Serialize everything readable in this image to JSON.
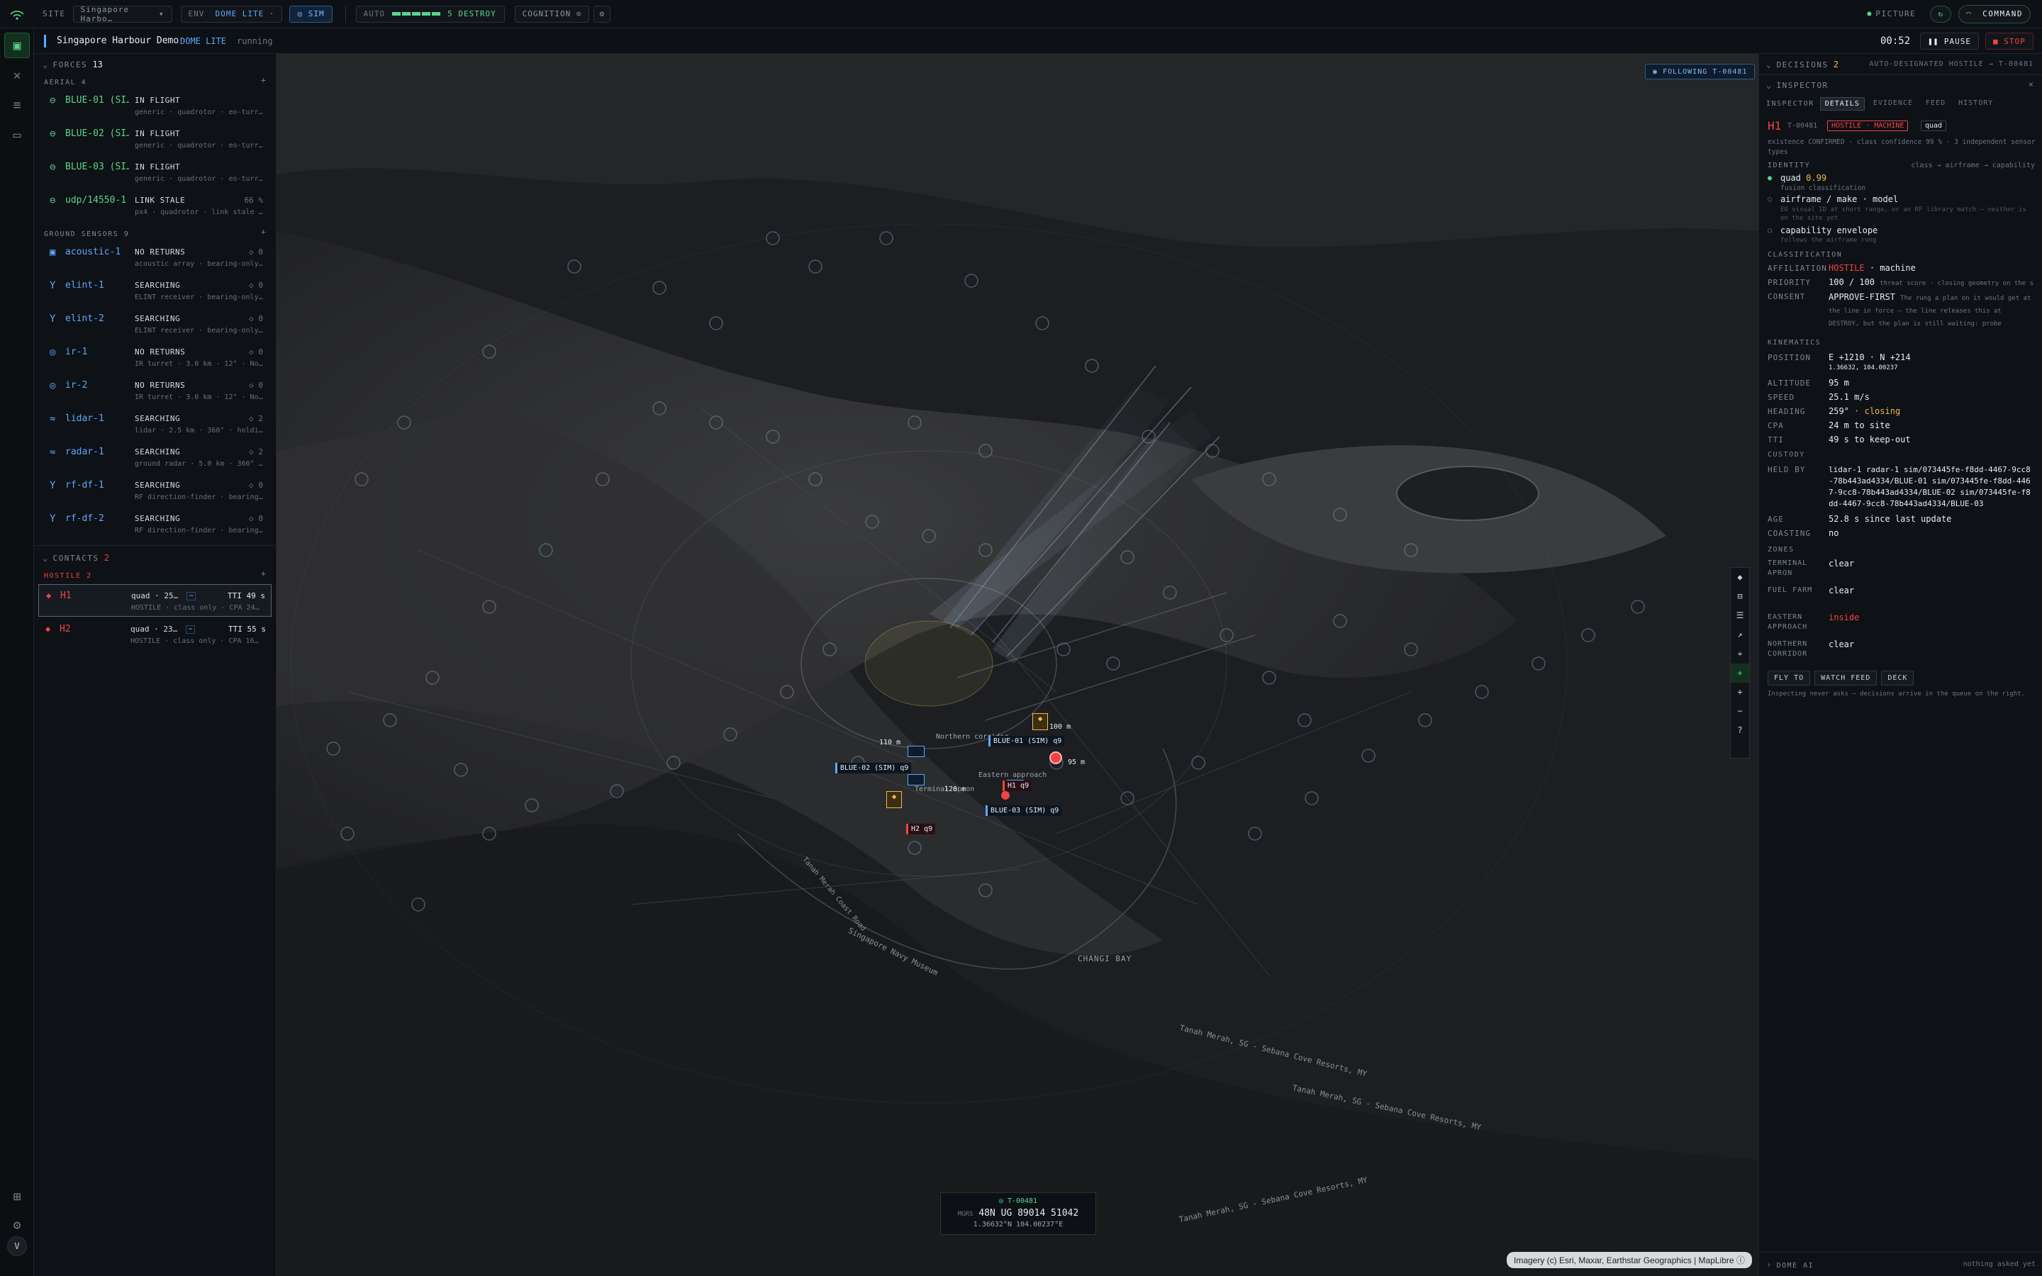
{
  "topbar": {
    "site_label": "SITE",
    "site_value": "Singapore Harbo…",
    "env_label": "ENV",
    "env_value": "DOME LITE",
    "sim_label": "SIM",
    "auto_label": "AUTO",
    "auto_value": "5 DESTROY",
    "auto_level": 5,
    "cognition_label": "COGNITION",
    "picture_label": "PICTURE",
    "command_label": "COMMAND"
  },
  "subbar": {
    "title": "Singapore Harbour Demo",
    "env": "DOME LITE",
    "status": "running",
    "clock": "00:52",
    "pause_label": "PAUSE",
    "stop_label": "STOP"
  },
  "forces": {
    "header": "FORCES",
    "count": "13",
    "aerial_header": "AERIAL 4",
    "aerial": [
      {
        "name": "BLUE-01 (SI…",
        "status": "IN FLIGHT",
        "desc": "generic · quadrotor · eo-turr…"
      },
      {
        "name": "BLUE-02 (SI…",
        "status": "IN FLIGHT",
        "desc": "generic · quadrotor · eo-turr…"
      },
      {
        "name": "BLUE-03 (SI…",
        "status": "IN FLIGHT",
        "desc": "generic · quadrotor · eo-turr…"
      },
      {
        "name": "udp/14550-1",
        "status": "LINK STALE",
        "count": "66 %",
        "desc": "px4 · quadrotor · link stale …"
      }
    ],
    "ground_header": "GROUND SENSORS 9",
    "ground": [
      {
        "name": "acoustic-1",
        "status": "NO RETURNS",
        "count": "◇ 0",
        "desc": "acoustic array · bearing-only…"
      },
      {
        "name": "elint-1",
        "status": "SEARCHING",
        "count": "◇ 0",
        "desc": "ELINT receiver · bearing-only…"
      },
      {
        "name": "elint-2",
        "status": "SEARCHING",
        "count": "◇ 0",
        "desc": "ELINT receiver · bearing-only…"
      },
      {
        "name": "ir-1",
        "status": "NO RETURNS",
        "count": "◇ 0",
        "desc": "IR turret · 3.0 km · 12° · No…"
      },
      {
        "name": "ir-2",
        "status": "NO RETURNS",
        "count": "◇ 0",
        "desc": "IR turret · 3.0 km · 12° · No…"
      },
      {
        "name": "lidar-1",
        "status": "SEARCHING",
        "count": "◇ 2",
        "desc": "lidar · 2.5 km · 360° · holdi…"
      },
      {
        "name": "radar-1",
        "status": "SEARCHING",
        "count": "◇ 2",
        "desc": "ground radar · 5.0 km · 360° …"
      },
      {
        "name": "rf-df-1",
        "status": "SEARCHING",
        "count": "◇ 0",
        "desc": "RF direction-finder · bearing…"
      },
      {
        "name": "rf-df-2",
        "status": "SEARCHING",
        "count": "◇ 0",
        "desc": "RF direction-finder · bearing…"
      }
    ]
  },
  "contacts": {
    "header": "CONTACTS",
    "count": "2",
    "hostile_header": "HOSTILE 2",
    "items": [
      {
        "name": "H1",
        "desc1": "quad · 25…",
        "tti": "TTI 49 s",
        "desc2": "HOSTILE · class only · CPA 24…"
      },
      {
        "name": "H2",
        "desc1": "quad · 23…",
        "tti": "TTI 55 s",
        "desc2": "HOSTILE · class only · CPA 16…"
      }
    ]
  },
  "map": {
    "following": "FOLLOWING T-00481",
    "labels": {
      "blue01": "BLUE-01 (SIM) q9",
      "blue02": "BLUE-02 (SIM) q9",
      "blue03": "BLUE-03 (SIM) q9",
      "h1": "H1 q9",
      "h2": "H2 q9",
      "alt110": "110 m",
      "alt120": "120 m",
      "alt95": "95 m",
      "alt100": "100 m",
      "north": "Northern corridor",
      "east": "Eastern approach",
      "apron": "Terminal apron"
    },
    "place_names": [
      "Tanah Merah, SG - Sebana Cove Resorts, MY",
      "Tanah Merah, SG - Sebana Cove Resorts, MY",
      "Tanah Merah, SG - Sebana Cove Resorts, MY",
      "CHANGI BAY",
      "Singapore Navy Museum",
      "Tanah Merah Coast Road"
    ],
    "readout": {
      "id": "T-00481",
      "mgrs_label": "MGRS",
      "mgrs": "48N UG 89014 51042",
      "latlon": "1.36632°N 104.00237°E"
    },
    "attribution": "Imagery (c) Esri, Maxar, Earthstar Geographics | MapLibre"
  },
  "decisions": {
    "label": "DECISIONS",
    "count": "2",
    "note": "AUTO-DESIGNATED HOSTILE → T-00481"
  },
  "inspector": {
    "title": "INSPECTOR",
    "tab_label": "INSPECTOR",
    "tabs": [
      "DETAILS",
      "EVIDENCE",
      "FEED",
      "HISTORY"
    ],
    "id": "H1",
    "track": "T-00481",
    "badge": "HOSTILE · MACHINE",
    "type_tag": "quad",
    "existence": "existence CONFIRMED · class confidence 99 % · 3 independent sensor types",
    "identity_header": "IDENTITY",
    "identity_chain": "class → airframe → capability",
    "id_class": "quad",
    "id_class_conf": "0.99",
    "id_class_sub": "fusion classification",
    "id_airframe": "airframe / make · model",
    "id_airframe_sub": "EO visual ID at short range, or an RF library match — neither is on the site yet",
    "id_cap": "capability envelope",
    "id_cap_sub": "follows the airframe rung",
    "classification_header": "CLASSIFICATION",
    "affiliation_label": "AFFILIATION",
    "affiliation_value": "HOSTILE",
    "affiliation_rest": "· machine",
    "priority_label": "PRIORITY",
    "priority_value": "100 / 100",
    "priority_note": "threat score · closing geometry on the site",
    "consent_label": "CONSENT",
    "consent_value": "APPROVE-FIRST",
    "consent_note": "The rung a plan on it would get at the line in force — the line releases this at DESTROY, but the plan is still waiting: probe",
    "kinematics_header": "KINEMATICS",
    "position_label": "POSITION",
    "position_value": "E +1210 · N +214",
    "position_sub": "1.36632, 104.00237",
    "altitude_label": "ALTITUDE",
    "altitude_value": "95 m",
    "speed_label": "SPEED",
    "speed_value": "25.1 m/s",
    "heading_label": "HEADING",
    "heading_value": "259°",
    "heading_note": "· closing",
    "cpa_label": "CPA",
    "cpa_value": "24 m to site",
    "tti_label": "TTI",
    "tti_value": "49 s to keep-out",
    "custody_header": "CUSTODY",
    "held_label": "HELD BY",
    "held_value": "lidar-1 radar-1 sim/073445fe-f8dd-4467-9cc8-78b443ad4334/BLUE-01 sim/073445fe-f8dd-4467-9cc8-78b443ad4334/BLUE-02 sim/073445fe-f8dd-4467-9cc8-78b443ad4334/BLUE-03",
    "age_label": "AGE",
    "age_value": "52.8 s since last update",
    "coasting_label": "COASTING",
    "coasting_value": "no",
    "zones_header": "ZONES",
    "zones": [
      {
        "name": "TERMINAL APRON",
        "value": "clear"
      },
      {
        "name": "FUEL FARM",
        "value": "clear"
      },
      {
        "name": "EASTERN APPROACH",
        "value": "inside"
      },
      {
        "name": "NORTHERN CORRIDOR",
        "value": "clear"
      }
    ],
    "actions": [
      "FLY TO",
      "WATCH FEED",
      "DECK"
    ],
    "footer_note": "Inspecting never asks — decisions arrive in the queue on the right."
  },
  "dome_ai": {
    "label": "DOME AI",
    "note": "nothing asked yet"
  },
  "rail_user": "V",
  "colors": {
    "accent": "#58d68d",
    "hostile": "#ef4444",
    "warning": "#f2b84b",
    "friendly": "#5fa8ff"
  }
}
